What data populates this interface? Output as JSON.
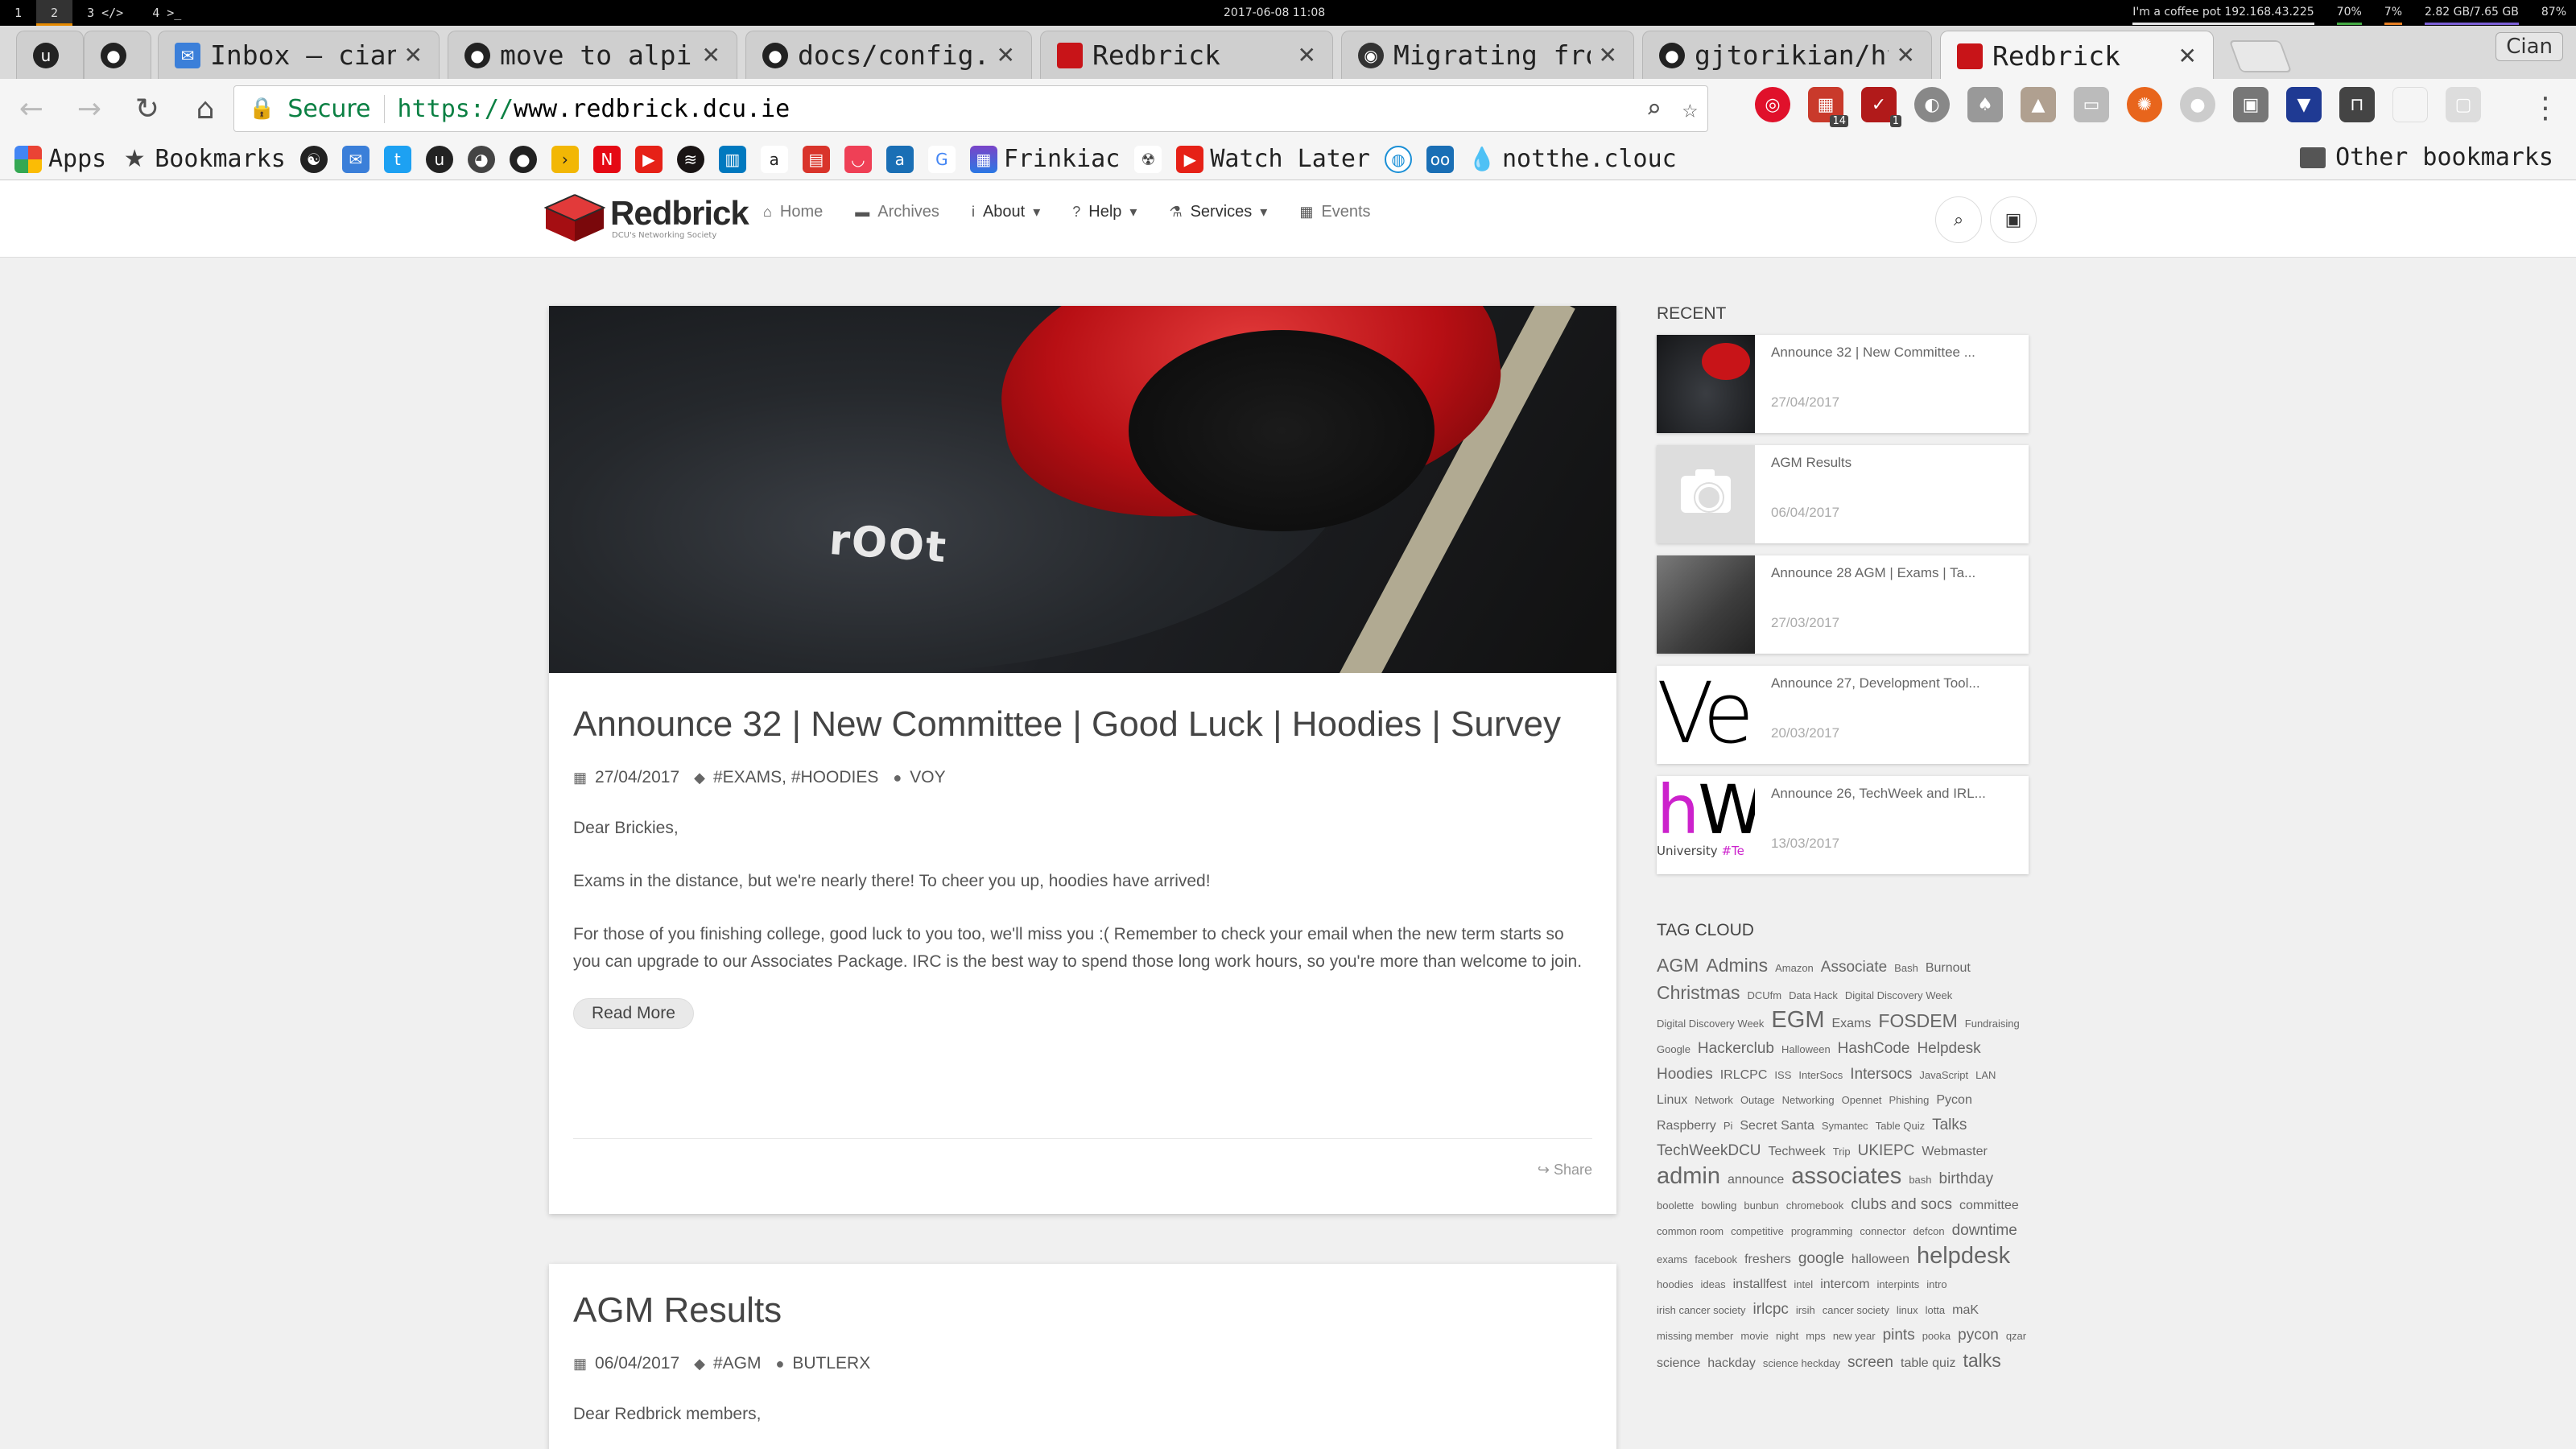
{
  "system_bar": {
    "workspaces": [
      "1",
      "2",
      "3 </>",
      "4 >_"
    ],
    "datetime": "2017-06-08  11:08",
    "network": "I'm a coffee pot 192.168.43.225",
    "battery": "70%",
    "cpu": "7%",
    "memory": "2.82 GB/7.65 GB",
    "volume": "87%"
  },
  "tabs": [
    {
      "title": "",
      "icon": "uv-icon"
    },
    {
      "title": "",
      "icon": "github-icon"
    },
    {
      "title": "Inbox – cianb",
      "icon": "inbox-icon"
    },
    {
      "title": "move to alpin",
      "icon": "github-icon"
    },
    {
      "title": "docs/config.y",
      "icon": "github-icon"
    },
    {
      "title": "Redbrick",
      "icon": "redbrick-icon"
    },
    {
      "title": "Migrating fro",
      "icon": "circleci-icon"
    },
    {
      "title": "gjtorikian/ht",
      "icon": "github-icon"
    },
    {
      "title": "Redbrick",
      "icon": "redbrick-icon"
    }
  ],
  "profile_name": "Cian",
  "address_bar": {
    "secure_label": "Secure",
    "url_scheme": "https://",
    "url_host": "www.redbrick.dcu.ie"
  },
  "extension_badges": {
    "gmail": "14",
    "todoist": "1"
  },
  "bookmarks": {
    "apps": "Apps",
    "bookmarks": "Bookmarks",
    "frinkiac": "Frinkiac",
    "watch_later": "Watch Later",
    "notthe": "notthe.clouc",
    "other": "Other bookmarks"
  },
  "site": {
    "brand": "Redbrick",
    "brand_sub": "DCU's Networking Society",
    "nav": [
      "Home",
      "Archives",
      "About",
      "Help",
      "Services",
      "Events"
    ]
  },
  "post": {
    "title": "Announce 32 | New Committee | Good Luck | Hoodies | Survey",
    "date": "27/04/2017",
    "tags": "#EXAMS, #HOODIES",
    "author": "VOY",
    "paragraphs": [
      "Dear Brickies,",
      "Exams in the distance, but we're nearly there! To cheer you up, hoodies have arrived!",
      "For those of you finishing college, good luck to you too, we'll miss you :( Remember to check your email when the new term starts so you can upgrade to our Associates Package. IRC is the best way to spend those long work hours, so you're more than welcome to join."
    ],
    "read_more": "Read More",
    "share": "Share",
    "hero_text": "rOOt"
  },
  "post2": {
    "title": "AGM Results",
    "date": "06/04/2017",
    "tags": "#AGM",
    "author": "BUTLERX",
    "paragraph": "Dear Redbrick members,"
  },
  "sidebar": {
    "recent_heading": "RECENT",
    "recent": [
      {
        "title": "Announce 32 | New Committee ...",
        "date": "27/04/2017"
      },
      {
        "title": "AGM Results",
        "date": "06/04/2017"
      },
      {
        "title": "Announce 28 AGM | Exams | Ta...",
        "date": "27/03/2017"
      },
      {
        "title": "Announce 27, Development Tool...",
        "date": "20/03/2017"
      },
      {
        "title": "Announce 26, TechWeek and IRL...",
        "date": "13/03/2017"
      }
    ],
    "thumb_ve": "Ve",
    "thumb_hw_h": "h",
    "thumb_hw_w": "W",
    "thumb_hw_small": "University",
    "thumb_hw_tag": "#Te",
    "tag_heading": "TAG CLOUD",
    "tags": [
      {
        "t": "AGM",
        "s": 4
      },
      {
        "t": "Admins",
        "s": 4
      },
      {
        "t": "Amazon",
        "s": 1
      },
      {
        "t": "Associate",
        "s": 3
      },
      {
        "t": "Bash",
        "s": 1
      },
      {
        "t": "Burnout",
        "s": 2
      },
      {
        "t": "Christmas",
        "s": 4
      },
      {
        "t": "DCUfm",
        "s": 1
      },
      {
        "t": "Data Hack",
        "s": 1
      },
      {
        "t": "Digital Discovery Week",
        "s": 1
      },
      {
        "t": "Digital Discovery Week",
        "s": 1
      },
      {
        "t": "EGM",
        "s": 5
      },
      {
        "t": "Exams",
        "s": 2
      },
      {
        "t": "FOSDEM",
        "s": 4
      },
      {
        "t": "Fundraising",
        "s": 1
      },
      {
        "t": "Google",
        "s": 1
      },
      {
        "t": "Hackerclub",
        "s": 3
      },
      {
        "t": "Halloween",
        "s": 1
      },
      {
        "t": "HashCode",
        "s": 3
      },
      {
        "t": "Helpdesk",
        "s": 3
      },
      {
        "t": "Hoodies",
        "s": 3
      },
      {
        "t": "IRLCPC",
        "s": 2
      },
      {
        "t": "ISS",
        "s": 1
      },
      {
        "t": "InterSocs",
        "s": 1
      },
      {
        "t": "Intersocs",
        "s": 3
      },
      {
        "t": "JavaScript",
        "s": 1
      },
      {
        "t": "LAN",
        "s": 1
      },
      {
        "t": "Linux",
        "s": 2
      },
      {
        "t": "Network",
        "s": 1
      },
      {
        "t": "Outage",
        "s": 1
      },
      {
        "t": "Networking",
        "s": 1
      },
      {
        "t": "Opennet",
        "s": 1
      },
      {
        "t": "Phishing",
        "s": 1
      },
      {
        "t": "Pycon",
        "s": 2
      },
      {
        "t": "Raspberry",
        "s": 2
      },
      {
        "t": "Pi",
        "s": 1
      },
      {
        "t": "Secret Santa",
        "s": 2
      },
      {
        "t": "Symantec",
        "s": 1
      },
      {
        "t": "Table Quiz",
        "s": 1
      },
      {
        "t": "Talks",
        "s": 3
      },
      {
        "t": "TechWeekDCU",
        "s": 3
      },
      {
        "t": "Techweek",
        "s": 2
      },
      {
        "t": "Trip",
        "s": 1
      },
      {
        "t": "UKIEPC",
        "s": 3
      },
      {
        "t": "Webmaster",
        "s": 2
      },
      {
        "t": "admin",
        "s": 5
      },
      {
        "t": "announce",
        "s": 2
      },
      {
        "t": "associates",
        "s": 5
      },
      {
        "t": "bash",
        "s": 1
      },
      {
        "t": "birthday",
        "s": 3
      },
      {
        "t": "boolette",
        "s": 1
      },
      {
        "t": "bowling",
        "s": 1
      },
      {
        "t": "bunbun",
        "s": 1
      },
      {
        "t": "chromebook",
        "s": 1
      },
      {
        "t": "clubs and socs",
        "s": 3
      },
      {
        "t": "committee",
        "s": 2
      },
      {
        "t": "common room",
        "s": 1
      },
      {
        "t": "competitive",
        "s": 1
      },
      {
        "t": "programming",
        "s": 1
      },
      {
        "t": "connector",
        "s": 1
      },
      {
        "t": "defcon",
        "s": 1
      },
      {
        "t": "downtime",
        "s": 3
      },
      {
        "t": "exams",
        "s": 1
      },
      {
        "t": "facebook",
        "s": 1
      },
      {
        "t": "freshers",
        "s": 2
      },
      {
        "t": "google",
        "s": 3
      },
      {
        "t": "halloween",
        "s": 2
      },
      {
        "t": "helpdesk",
        "s": 5
      },
      {
        "t": "hoodies",
        "s": 1
      },
      {
        "t": "ideas",
        "s": 1
      },
      {
        "t": "installfest",
        "s": 2
      },
      {
        "t": "intel",
        "s": 1
      },
      {
        "t": "intercom",
        "s": 2
      },
      {
        "t": "interpints",
        "s": 1
      },
      {
        "t": "intro",
        "s": 1
      },
      {
        "t": "irish cancer society",
        "s": 1
      },
      {
        "t": "irlcpc",
        "s": 3
      },
      {
        "t": "irsih",
        "s": 1
      },
      {
        "t": "cancer society",
        "s": 1
      },
      {
        "t": "linux",
        "s": 1
      },
      {
        "t": "lotta",
        "s": 1
      },
      {
        "t": "maK",
        "s": 2
      },
      {
        "t": "missing member",
        "s": 1
      },
      {
        "t": "movie",
        "s": 1
      },
      {
        "t": "night",
        "s": 1
      },
      {
        "t": "mps",
        "s": 1
      },
      {
        "t": "new year",
        "s": 1
      },
      {
        "t": "pints",
        "s": 3
      },
      {
        "t": "pooka",
        "s": 1
      },
      {
        "t": "pycon",
        "s": 3
      },
      {
        "t": "qzar",
        "s": 1
      },
      {
        "t": "science",
        "s": 2
      },
      {
        "t": "hackday",
        "s": 2
      },
      {
        "t": "science heckday",
        "s": 1
      },
      {
        "t": "screen",
        "s": 3
      },
      {
        "t": "table quiz",
        "s": 2
      },
      {
        "t": "talks",
        "s": 4
      }
    ]
  },
  "colors": {
    "brand_red": "#c81418",
    "secure_green": "#0b8043",
    "page_bg": "#f0f0f0"
  }
}
